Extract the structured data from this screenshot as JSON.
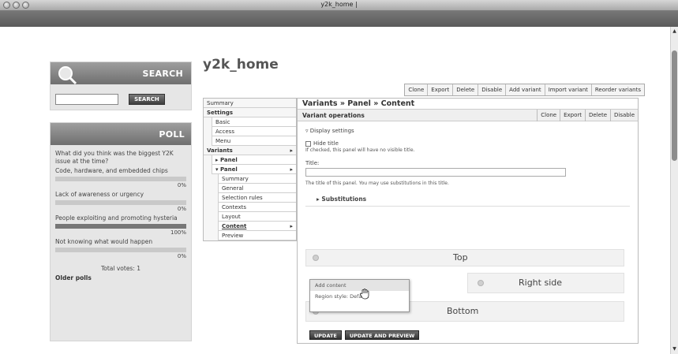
{
  "window": {
    "title": "y2k_home |"
  },
  "search": {
    "heading": "SEARCH",
    "button": "SEARCH",
    "value": ""
  },
  "poll": {
    "heading": "POLL",
    "question": "What did you think was the biggest Y2K issue at the time?",
    "choices": [
      {
        "label": "Code, hardware, and embedded chips",
        "percent": "0%",
        "fraction": 0
      },
      {
        "label": "Lack of awareness or urgency",
        "percent": "0%",
        "fraction": 0
      },
      {
        "label": "People exploiting and promoting hysteria",
        "percent": "100%",
        "fraction": 1
      },
      {
        "label": "Not knowing what would happen",
        "percent": "0%",
        "fraction": 0
      }
    ],
    "total": "Total votes: 1",
    "older": "Older polls"
  },
  "page": {
    "title": "y2k_home"
  },
  "top_ops": [
    "Clone",
    "Export",
    "Delete",
    "Disable",
    "Add variant",
    "Import variant",
    "Reorder variants"
  ],
  "vtabs": {
    "summary": "Summary",
    "settings": "Settings",
    "basic": "Basic",
    "access": "Access",
    "menu": "Menu",
    "variants": "Variants",
    "panel1": "▸ Panel",
    "panel2": "▾ Panel",
    "summary2": "Summary",
    "general": "General",
    "selection_rules": "Selection rules",
    "contexts": "Contexts",
    "layout": "Layout",
    "content": "Content",
    "preview": "Preview"
  },
  "panel": {
    "breadcrumb": "Variants » Panel » Content",
    "variant_operations": "Variant operations",
    "variant_ops": [
      "Clone",
      "Export",
      "Delete",
      "Disable"
    ],
    "display_settings": "▿ Display settings",
    "hide_title": "Hide title",
    "hide_title_help": "If checked, this panel will have no visible title.",
    "title_label": "Title:",
    "title_value": "",
    "title_help": "The title of this panel. You may use substitutions in this title.",
    "substitutions": "▸ Substitutions",
    "regions": {
      "top": "Top",
      "right": "Right side",
      "bottom": "Bottom"
    },
    "popup": {
      "add_content": "Add content",
      "region_style": "Region style: Default"
    },
    "update": "UPDATE",
    "update_preview": "UPDATE AND PREVIEW"
  }
}
